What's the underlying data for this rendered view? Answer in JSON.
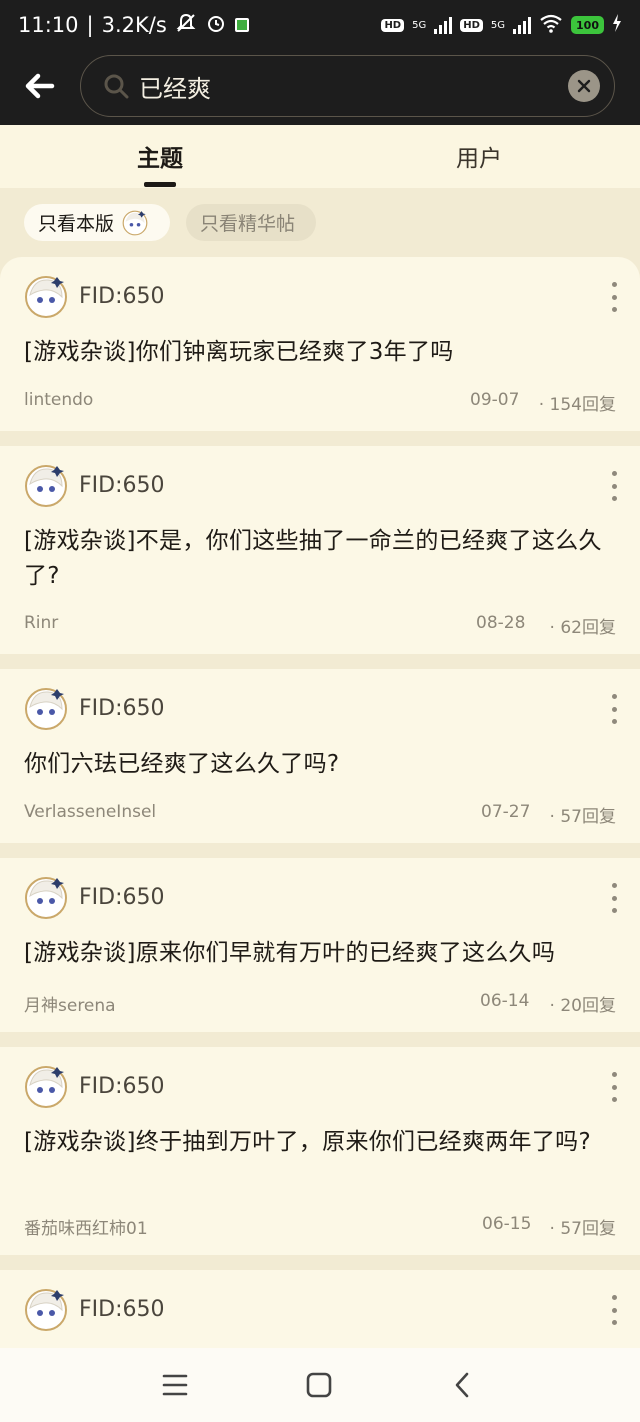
{
  "status_bar": {
    "time": "11:10",
    "speed": "3.2K/s",
    "battery": "100",
    "signal1": "5G",
    "signal2": "5G",
    "hd": "HD"
  },
  "search": {
    "query": "已经爽",
    "back_icon": "arrow-left-icon",
    "search_icon": "magnifier-icon",
    "clear_icon": "close-icon"
  },
  "tabs": {
    "topic": "主题",
    "user": "用户"
  },
  "filters": {
    "board_only": "只看本版",
    "elite_only": "只看精华帖"
  },
  "posts": [
    {
      "fid": "FID:650",
      "title": "[游戏杂谈]你们钟离玩家已经爽了3年了吗",
      "author": "lintendo",
      "date": "09-07",
      "replies": "· 154回复"
    },
    {
      "fid": "FID:650",
      "title": "[游戏杂谈]不是，你们这些抽了一命兰的已经爽了这么久了?",
      "author": "Rinr",
      "date": "08-28",
      "replies": "· 62回复"
    },
    {
      "fid": "FID:650",
      "title": "你们六珐已经爽了这么久了吗?",
      "author": "VerlasseneInsel",
      "date": "07-27",
      "replies": "· 57回复"
    },
    {
      "fid": "FID:650",
      "title": "[游戏杂谈]原来你们早就有万叶的已经爽了这么久吗",
      "author": "月神serena",
      "date": "06-14",
      "replies": "· 20回复"
    },
    {
      "fid": "FID:650",
      "title": "[游戏杂谈]终于抽到万叶了，原来你们已经爽两年了吗?",
      "author": "番茄味西红柿01",
      "date": "06-15",
      "replies": "· 57回复"
    },
    {
      "fid": "FID:650"
    }
  ],
  "colors": {
    "header_bg": "#1d1d1d",
    "page_bg": "#f2ebd3",
    "card_bg": "#fcf8e6",
    "muted_text": "#8d8779"
  }
}
